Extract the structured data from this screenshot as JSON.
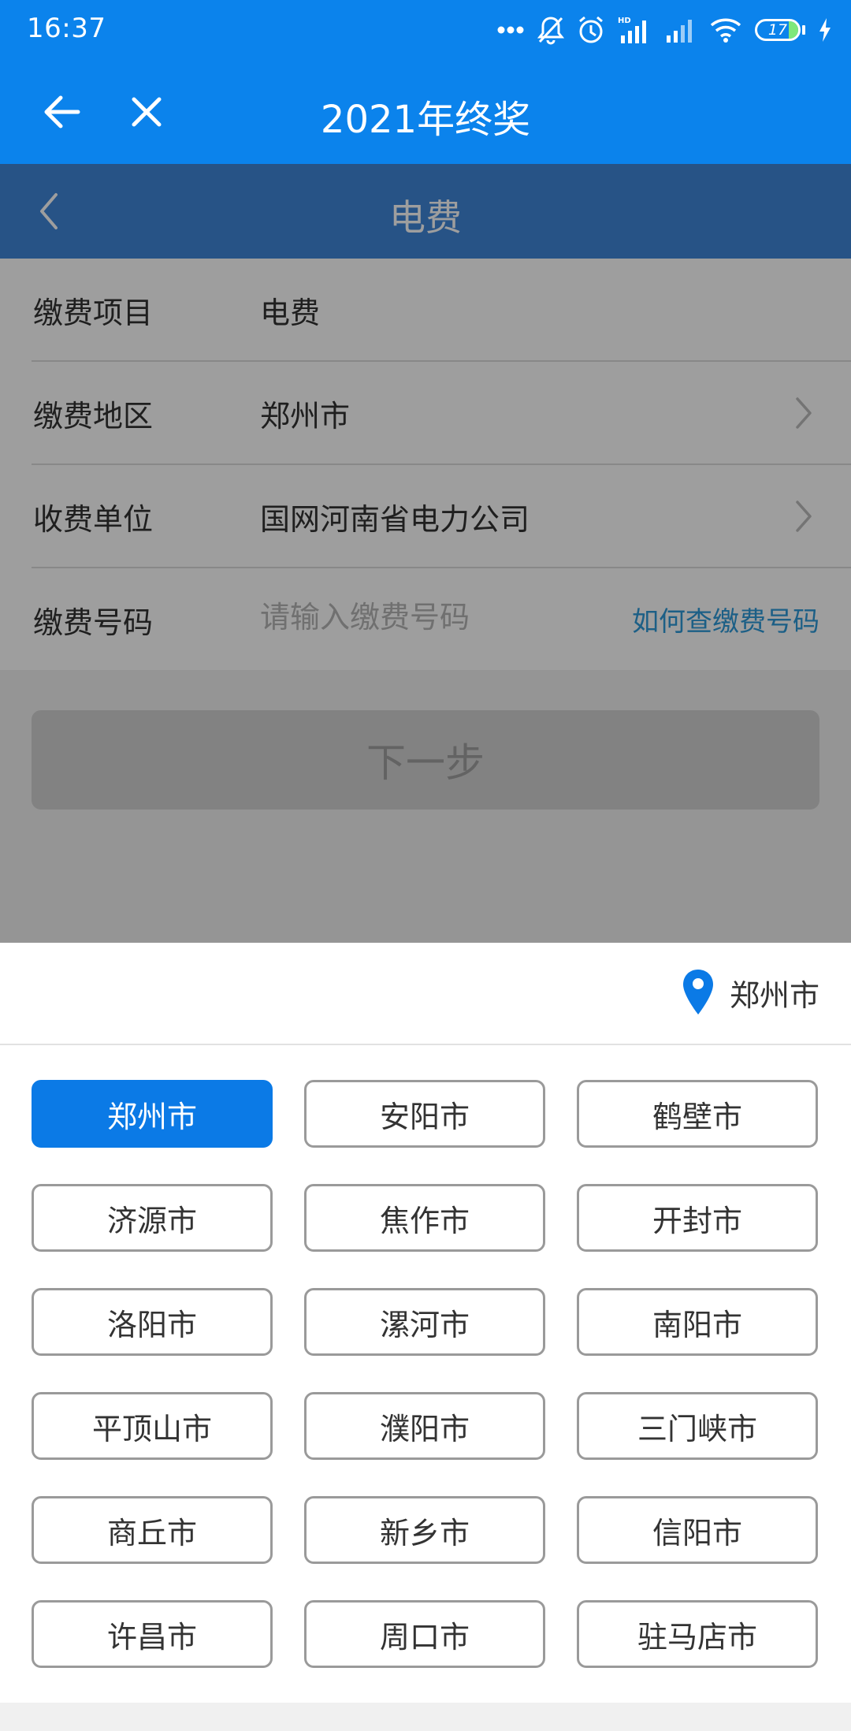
{
  "status_bar": {
    "time": "16:37",
    "battery_level": "17",
    "icons": [
      "more-dots-icon",
      "bell-muted-icon",
      "alarm-icon",
      "hd-signal-icon",
      "signal-icon",
      "wifi-icon",
      "battery-icon",
      "charging-bolt-icon"
    ]
  },
  "app_bar": {
    "title": "2021年终奖",
    "back_icon": "arrow-left-icon",
    "close_icon": "close-icon"
  },
  "sub_header": {
    "title": "电费",
    "back_icon": "chevron-left-icon"
  },
  "form": {
    "rows": [
      {
        "label": "缴费项目",
        "value": "电费"
      },
      {
        "label": "缴费地区",
        "value": "郑州市"
      },
      {
        "label": "收费单位",
        "value": "国网河南省电力公司"
      },
      {
        "label": "缴费号码",
        "placeholder": "请输入缴费号码",
        "link": "如何查缴费号码"
      }
    ],
    "next_button": "下一步"
  },
  "city_picker": {
    "current_location": "郑州市",
    "selected": "郑州市",
    "cities": [
      "郑州市",
      "安阳市",
      "鹤壁市",
      "济源市",
      "焦作市",
      "开封市",
      "洛阳市",
      "漯河市",
      "南阳市",
      "平顶山市",
      "濮阳市",
      "三门峡市",
      "商丘市",
      "新乡市",
      "信阳市",
      "许昌市",
      "周口市",
      "驻马店市"
    ]
  },
  "colors": {
    "primary": "#0b83ec",
    "sub_header": "#3f86d8",
    "selected_city": "#0b7ae6",
    "link": "#2e9ad9"
  }
}
